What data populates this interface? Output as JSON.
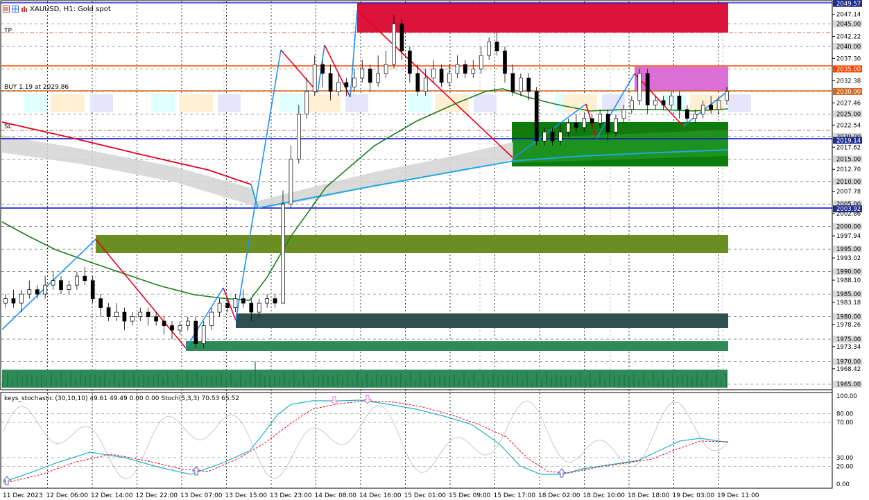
{
  "chart_header": {
    "symbol_timeframe": "XAUUSD, H1:",
    "description": "Gold spot"
  },
  "overlay_labels": {
    "tp": "TP",
    "sl": "SL",
    "buy_order": "BUY 1.19 at 2029.86"
  },
  "price_axis": {
    "labels": [
      "2047.14",
      "2042.22",
      "2037.30",
      "2032.38",
      "2027.46",
      "2022.54",
      "2017.62",
      "2012.70",
      "2007.78",
      "2002.86",
      "1997.94",
      "1993.02",
      "1988.10",
      "1983.18",
      "1978.26",
      "1973.34",
      "1968.42"
    ],
    "round_levels": [
      "2045.00",
      "2040.00",
      "2035.00",
      "2030.00",
      "2025.00",
      "2020.00",
      "2015.00",
      "2010.00",
      "2005.00",
      "2000.00",
      "1995.00",
      "1990.00",
      "1985.00",
      "1980.00",
      "1975.00",
      "1970.00",
      "1965.00"
    ],
    "current_price_tag": "2049.57",
    "level_2019": "2019.14",
    "level_2003": "2003.92"
  },
  "time_axis": {
    "labels": [
      "11 Dec 2023",
      "12 Dec 06:00",
      "12 Dec 14:00",
      "12 Dec 22:00",
      "13 Dec 07:00",
      "13 Dec 15:00",
      "13 Dec 23:00",
      "14 Dec 08:00",
      "14 Dec 16:00",
      "15 Dec 01:00",
      "15 Dec 09:00",
      "15 Dec 17:00",
      "18 Dec 02:00",
      "18 Dec 10:00",
      "18 Dec 18:00",
      "19 Dec 03:00",
      "19 Dec 11:00"
    ]
  },
  "indicator": {
    "label": "keys_stochastic (30,10,10) 49.61 49.49 0.00 0.00 Stoch(5,3,3) 70.53 65.52",
    "levels": [
      "100.00",
      "80.00",
      "70.00",
      "30.00",
      "20.00",
      "0.00"
    ]
  },
  "colors": {
    "bull_candle": "#ffffff",
    "bear_candle": "#000000",
    "zigzag_up": "#1e90ff",
    "zigzag_down": "#e8001c",
    "ma_green": "#1a7f1a",
    "ma_blue": "#1ea7e8",
    "supply_zone": "#dc143c",
    "demand_zone": "#0a7d0a",
    "horizontal_blue": "#0000c8",
    "horizontal_orange": "#ff4500"
  }
}
